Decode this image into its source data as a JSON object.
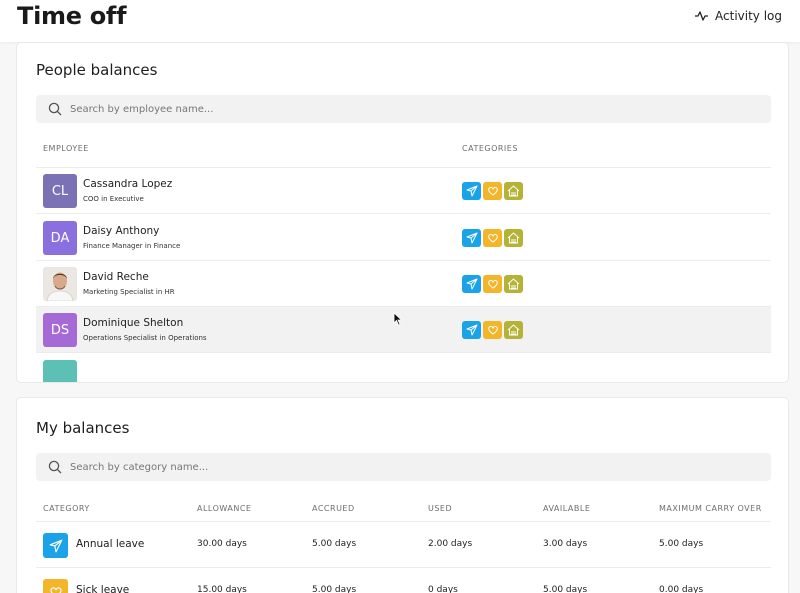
{
  "header": {
    "title": "Time off",
    "activity_label": "Activity log"
  },
  "people_balances": {
    "title": "People balances",
    "search_placeholder": "Search by employee name...",
    "columns": {
      "employee": "EMPLOYEE",
      "categories": "CATEGORIES"
    },
    "rows": [
      {
        "initials": "CL",
        "name": "Cassandra Lopez",
        "role": "COO in Executive",
        "avatar_color": "#7b72b6"
      },
      {
        "initials": "DA",
        "name": "Daisy Anthony",
        "role": "Finance Manager in Finance",
        "avatar_color": "#8a6fdf"
      },
      {
        "initials": "",
        "name": "David Reche",
        "role": "Marketing Specialist in HR",
        "avatar_color": "#e7e2dc"
      },
      {
        "initials": "DS",
        "name": "Dominique Shelton",
        "role": "Operations Specialist in Operations",
        "avatar_color": "#a66ad6"
      }
    ],
    "category_colors": {
      "annual": "#1aa3e8",
      "sick": "#f3b52a",
      "home": "#b4b336"
    }
  },
  "my_balances": {
    "title": "My balances",
    "search_placeholder": "Search by category name...",
    "columns": {
      "category": "CATEGORY",
      "allowance": "ALLOWANCE",
      "accrued": "ACCRUED",
      "used": "USED",
      "available": "AVAILABLE",
      "max_carry": "MAXIMUM CARRY OVER"
    },
    "rows": [
      {
        "name": "Annual leave",
        "icon": "plane-icon",
        "color": "#1aa3e8",
        "allowance": "30.00 days",
        "accrued": "5.00 days",
        "used": "2.00 days",
        "available": "3.00 days",
        "max_carry": "5.00 days"
      },
      {
        "name": "Sick leave",
        "icon": "heart-icon",
        "color": "#f3b52a",
        "allowance": "15.00 days",
        "accrued": "5.00 days",
        "used": "0 days",
        "available": "5.00 days",
        "max_carry": "0.00 days"
      }
    ]
  }
}
